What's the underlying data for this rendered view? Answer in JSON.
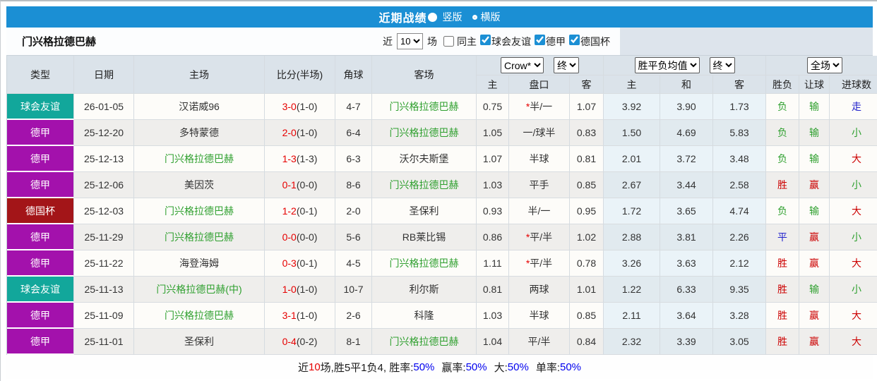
{
  "titlebar": {
    "title": "近期战绩",
    "orientation_options": [
      {
        "label": "竖版",
        "selected": true
      },
      {
        "label": "横版",
        "selected": false
      }
    ]
  },
  "subheader": {
    "team": "门兴格拉德巴赫",
    "recent_prefix": "近",
    "recent_count": "10",
    "recent_suffix": "场",
    "same_home": {
      "label": "同主",
      "checked": false
    },
    "competition_filters": [
      {
        "label": "球会友谊",
        "checked": true
      },
      {
        "label": "德甲",
        "checked": true
      },
      {
        "label": "德国杯",
        "checked": true
      }
    ]
  },
  "table": {
    "main_headers": [
      "类型",
      "日期",
      "主场",
      "比分(半场)",
      "角球",
      "客场"
    ],
    "group_selects": {
      "odds_source": "Crow*",
      "odds_time": "终",
      "avg_source": "胜平负均值",
      "avg_time": "终",
      "scope": "全场"
    },
    "sub_headers": [
      "主",
      "盘口",
      "客",
      "主",
      "和",
      "客",
      "胜负",
      "让球",
      "进球数"
    ],
    "rows": [
      {
        "type": "球会友谊",
        "type_color": "friendly",
        "date": "26-01-05",
        "home": "汉诺威96",
        "home_focus": false,
        "score": "3-0",
        "half": "(1-0)",
        "corners": "4-7",
        "away": "门兴格拉德巴赫",
        "away_focus": true,
        "odds_home": "0.75",
        "handicap_star": "*",
        "handicap": "半/一",
        "odds_away": "1.07",
        "avg_home": "3.92",
        "avg_draw": "3.90",
        "avg_away": "1.73",
        "wdl": "负",
        "wdl_color": "green",
        "handicap_result": "输",
        "handicap_result_color": "green",
        "goals": "走",
        "goals_color": "blue"
      },
      {
        "type": "德甲",
        "type_color": "league",
        "date": "25-12-20",
        "home": "多特蒙德",
        "home_focus": false,
        "score": "2-0",
        "half": "(1-0)",
        "corners": "6-4",
        "away": "门兴格拉德巴赫",
        "away_focus": true,
        "odds_home": "1.05",
        "handicap_star": "",
        "handicap": "一/球半",
        "odds_away": "0.83",
        "avg_home": "1.50",
        "avg_draw": "4.69",
        "avg_away": "5.83",
        "wdl": "负",
        "wdl_color": "green",
        "handicap_result": "输",
        "handicap_result_color": "green",
        "goals": "小",
        "goals_color": "green"
      },
      {
        "type": "德甲",
        "type_color": "league",
        "date": "25-12-13",
        "home": "门兴格拉德巴赫",
        "home_focus": true,
        "score": "1-3",
        "half": "(1-3)",
        "corners": "6-3",
        "away": "沃尔夫斯堡",
        "away_focus": false,
        "odds_home": "1.07",
        "handicap_star": "",
        "handicap": "半球",
        "odds_away": "0.81",
        "avg_home": "2.01",
        "avg_draw": "3.72",
        "avg_away": "3.48",
        "wdl": "负",
        "wdl_color": "green",
        "handicap_result": "输",
        "handicap_result_color": "green",
        "goals": "大",
        "goals_color": "red"
      },
      {
        "type": "德甲",
        "type_color": "league",
        "date": "25-12-06",
        "home": "美因茨",
        "home_focus": false,
        "score": "0-1",
        "half": "(0-0)",
        "corners": "8-6",
        "away": "门兴格拉德巴赫",
        "away_focus": true,
        "odds_home": "1.03",
        "handicap_star": "",
        "handicap": "平手",
        "odds_away": "0.85",
        "avg_home": "2.67",
        "avg_draw": "3.44",
        "avg_away": "2.58",
        "wdl": "胜",
        "wdl_color": "red",
        "handicap_result": "赢",
        "handicap_result_color": "red",
        "goals": "小",
        "goals_color": "green"
      },
      {
        "type": "德国杯",
        "type_color": "cup",
        "date": "25-12-03",
        "home": "门兴格拉德巴赫",
        "home_focus": true,
        "score": "1-2",
        "half": "(0-1)",
        "corners": "2-0",
        "away": "圣保利",
        "away_focus": false,
        "odds_home": "0.93",
        "handicap_star": "",
        "handicap": "半/一",
        "odds_away": "0.95",
        "avg_home": "1.72",
        "avg_draw": "3.65",
        "avg_away": "4.74",
        "wdl": "负",
        "wdl_color": "green",
        "handicap_result": "输",
        "handicap_result_color": "green",
        "goals": "大",
        "goals_color": "red"
      },
      {
        "type": "德甲",
        "type_color": "league",
        "date": "25-11-29",
        "home": "门兴格拉德巴赫",
        "home_focus": true,
        "score": "0-0",
        "half": "(0-0)",
        "corners": "5-6",
        "away": "RB莱比锡",
        "away_focus": false,
        "odds_home": "0.86",
        "handicap_star": "*",
        "handicap": "平/半",
        "odds_away": "1.02",
        "avg_home": "2.88",
        "avg_draw": "3.81",
        "avg_away": "2.26",
        "wdl": "平",
        "wdl_color": "blue",
        "handicap_result": "赢",
        "handicap_result_color": "red",
        "goals": "小",
        "goals_color": "green"
      },
      {
        "type": "德甲",
        "type_color": "league",
        "date": "25-11-22",
        "home": "海登海姆",
        "home_focus": false,
        "score": "0-3",
        "half": "(0-1)",
        "corners": "4-5",
        "away": "门兴格拉德巴赫",
        "away_focus": true,
        "odds_home": "1.11",
        "handicap_star": "*",
        "handicap": "平/半",
        "odds_away": "0.78",
        "avg_home": "3.26",
        "avg_draw": "3.63",
        "avg_away": "2.12",
        "wdl": "胜",
        "wdl_color": "red",
        "handicap_result": "赢",
        "handicap_result_color": "red",
        "goals": "大",
        "goals_color": "red"
      },
      {
        "type": "球会友谊",
        "type_color": "friendly",
        "date": "25-11-13",
        "home": "门兴格拉德巴赫(中)",
        "home_focus": true,
        "score": "1-0",
        "half": "(1-0)",
        "corners": "10-7",
        "away": "利尔斯",
        "away_focus": false,
        "odds_home": "0.81",
        "handicap_star": "",
        "handicap": "两球",
        "odds_away": "1.01",
        "avg_home": "1.22",
        "avg_draw": "6.33",
        "avg_away": "9.35",
        "wdl": "胜",
        "wdl_color": "red",
        "handicap_result": "输",
        "handicap_result_color": "green",
        "goals": "小",
        "goals_color": "green"
      },
      {
        "type": "德甲",
        "type_color": "league",
        "date": "25-11-09",
        "home": "门兴格拉德巴赫",
        "home_focus": true,
        "score": "3-1",
        "half": "(1-0)",
        "corners": "2-6",
        "away": "科隆",
        "away_focus": false,
        "odds_home": "1.03",
        "handicap_star": "",
        "handicap": "半球",
        "odds_away": "0.85",
        "avg_home": "2.11",
        "avg_draw": "3.64",
        "avg_away": "3.28",
        "wdl": "胜",
        "wdl_color": "red",
        "handicap_result": "赢",
        "handicap_result_color": "red",
        "goals": "大",
        "goals_color": "red"
      },
      {
        "type": "德甲",
        "type_color": "league",
        "date": "25-11-01",
        "home": "圣保利",
        "home_focus": false,
        "score": "0-4",
        "half": "(0-2)",
        "corners": "8-1",
        "away": "门兴格拉德巴赫",
        "away_focus": true,
        "odds_home": "1.04",
        "handicap_star": "",
        "handicap": "平/半",
        "odds_away": "0.84",
        "avg_home": "2.32",
        "avg_draw": "3.39",
        "avg_away": "3.05",
        "wdl": "胜",
        "wdl_color": "red",
        "handicap_result": "赢",
        "handicap_result_color": "red",
        "goals": "大",
        "goals_color": "red"
      }
    ]
  },
  "footer": {
    "part1": "近",
    "count": "10",
    "part2": "场,胜5平1负4, 胜率:",
    "win_rate": "50%",
    "label_handicap": "赢率:",
    "handicap_rate": "50%",
    "label_big": "大:",
    "big_rate": "50%",
    "label_single": "单率:",
    "single_rate": "50%"
  },
  "colors": {
    "accent_blue": "#1B8FD4",
    "badge_friendly": "#12A79B",
    "badge_league": "#A311AC",
    "badge_cup": "#A31518",
    "focus_team_green": "#2FA02F",
    "score_red": "#E60000",
    "result_red": "#CC0000",
    "result_green": "#2FA02F",
    "result_blue": "#2222CC",
    "rate_blue": "#0000EE"
  }
}
